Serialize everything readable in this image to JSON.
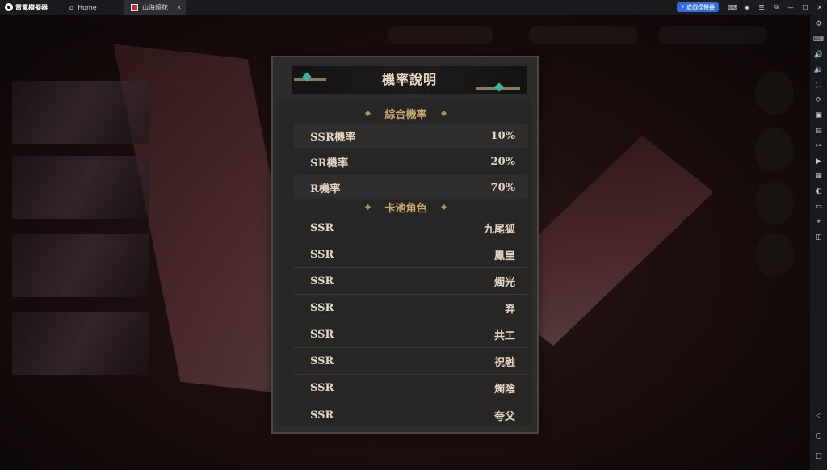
{
  "titlebar": {
    "app_name": "雷電模擬器",
    "tabs": [
      {
        "label": "Home",
        "icon": "home-icon"
      },
      {
        "label": "山海鏡花",
        "icon": "game-thumbnail"
      }
    ],
    "multi_instance_button": "遊戲模擬器",
    "window_icons": [
      "gamepad-icon",
      "account-icon",
      "menu-icon",
      "restore-icon",
      "minimize-icon",
      "maximize-icon",
      "close-icon"
    ]
  },
  "sidebar": {
    "icons": [
      "settings-icon",
      "keyboard-icon",
      "volume-up-icon",
      "volume-down-icon",
      "fullscreen-icon",
      "rotate-icon",
      "screenshot-icon",
      "apk-icon",
      "scissors-icon",
      "record-icon",
      "script-icon",
      "sync-icon",
      "folder-icon",
      "location-icon",
      "shake-icon"
    ],
    "nav_icons": [
      "back-icon",
      "home-circle-icon",
      "recents-icon"
    ]
  },
  "dialog": {
    "title": "機率說明",
    "section_overall": "綜合機率",
    "rates": [
      {
        "label": "SSR機率",
        "value": "10%"
      },
      {
        "label": "SR機率",
        "value": "20%"
      },
      {
        "label": "R機率",
        "value": "70%"
      }
    ],
    "section_pool": "卡池角色",
    "characters": [
      {
        "rarity": "SSR",
        "name": "九尾狐"
      },
      {
        "rarity": "SSR",
        "name": "鳳皇"
      },
      {
        "rarity": "SSR",
        "name": "燭光"
      },
      {
        "rarity": "SSR",
        "name": "羿"
      },
      {
        "rarity": "SSR",
        "name": "共工"
      },
      {
        "rarity": "SSR",
        "name": "祝融"
      },
      {
        "rarity": "SSR",
        "name": "燭陰"
      },
      {
        "rarity": "SSR",
        "name": "夸父"
      }
    ]
  },
  "colors": {
    "title_text": "#ead9c0",
    "section_gold": "#c9a86a",
    "row_text": "#e3d5bd",
    "accent_blue": "#2d6ae5"
  }
}
